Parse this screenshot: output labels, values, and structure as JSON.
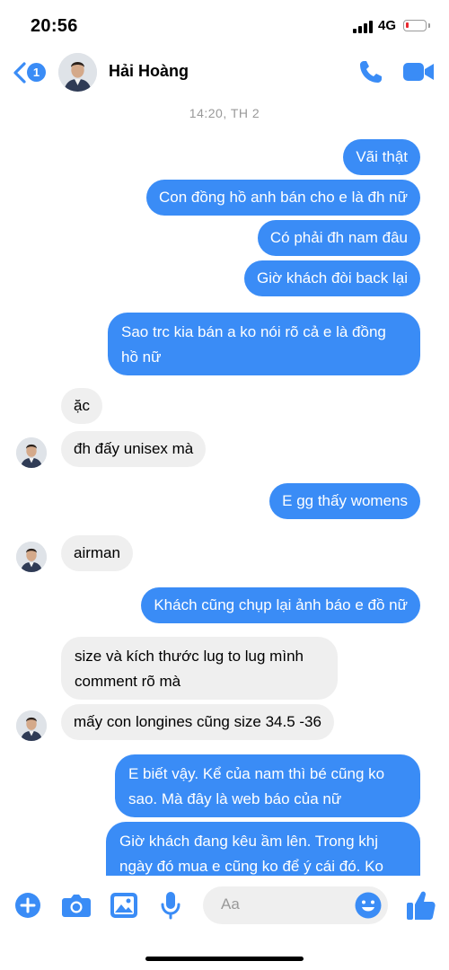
{
  "status_bar": {
    "time": "20:56",
    "network": "4G",
    "battery_level": 0.15
  },
  "header": {
    "unread_count": "1",
    "contact_name": "Hải Hoàng"
  },
  "timestamp": "14:20, TH 2",
  "messages": [
    {
      "from": "me",
      "text": "Vãi thật"
    },
    {
      "from": "me",
      "text": "Con đồng hồ anh bán cho e là đh nữ"
    },
    {
      "from": "me",
      "text": "Có phải đh nam đâu"
    },
    {
      "from": "me",
      "text": "Giờ khách đòi back lại"
    },
    {
      "from": "me",
      "text": "Sao trc kia bán a ko nói rõ cả e là đồng hồ nữ"
    },
    {
      "from": "them",
      "text": "ặc"
    },
    {
      "from": "them",
      "text": "đh đấy unisex mà"
    },
    {
      "from": "me",
      "text": "E gg thấy womens"
    },
    {
      "from": "them",
      "text": "airman"
    },
    {
      "from": "me",
      "text": "Khách cũng chụp lại ảnh báo e đồ nữ"
    },
    {
      "from": "them",
      "text": "size và kích thước lug to lug mình comment rõ mà"
    },
    {
      "from": "them",
      "text": "mấy con longines cũng size 34.5 -36"
    },
    {
      "from": "me",
      "text": "E biết vậy. Kể của nam thì bé cũng ko sao. Mà đây là web báo của nữ"
    },
    {
      "from": "me",
      "text": "Giờ khách đang kêu ầm lên. Trong khj ngày đó mua e cũng ko để ý cái đó. Ko"
    }
  ],
  "composer": {
    "placeholder": "Aa"
  },
  "colors": {
    "accent": "#3a8cf6",
    "incoming_bubble": "#efefef",
    "battery_low": "#e8292f"
  },
  "icons": [
    "back-chevron-icon",
    "phone-icon",
    "video-camera-icon",
    "plus-icon",
    "camera-icon",
    "image-icon",
    "microphone-icon",
    "emoji-icon",
    "thumbs-up-icon"
  ]
}
